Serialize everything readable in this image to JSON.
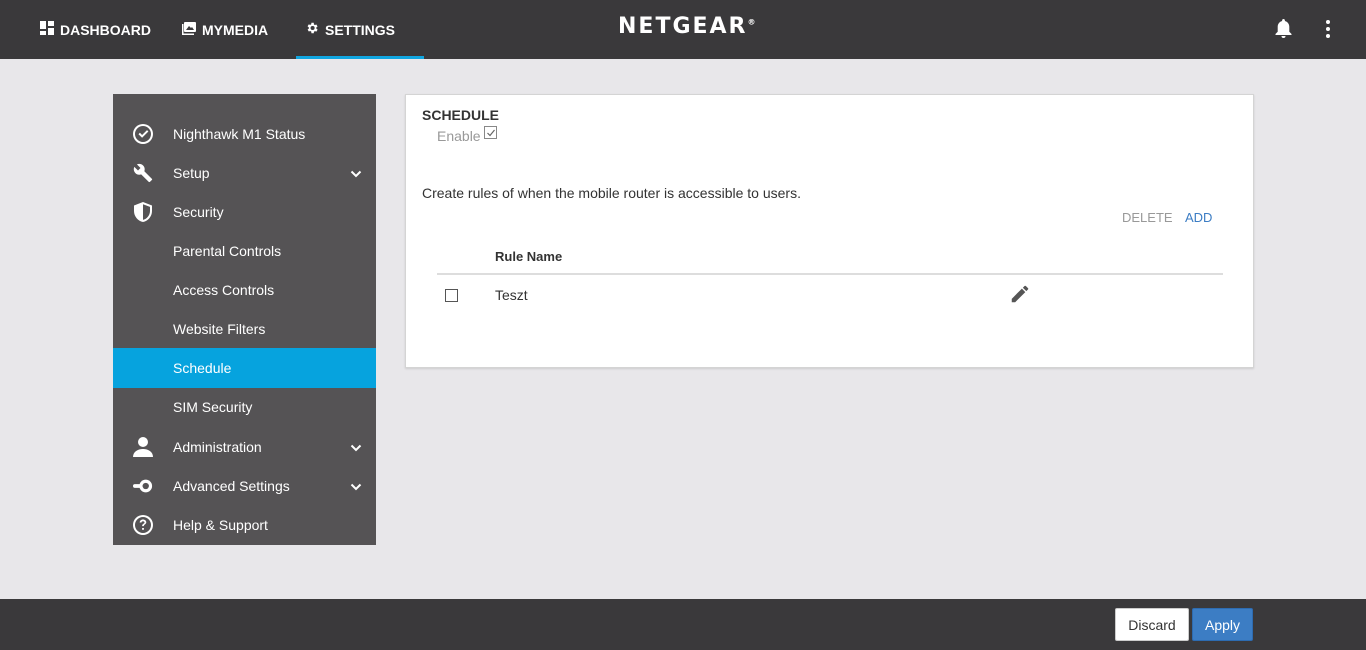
{
  "topnav": {
    "tabs": [
      {
        "label": "DASHBOARD",
        "icon": "dashboard-icon"
      },
      {
        "label": "MYMEDIA",
        "icon": "media-icon"
      },
      {
        "label": "SETTINGS",
        "icon": "gear-icon",
        "active": true
      }
    ],
    "brand": "NETGEAR",
    "brand_mark": "®",
    "accent_color": "#11a6e0"
  },
  "sidebar": {
    "items": [
      {
        "label": "Nighthawk M1 Status",
        "icon": "check-circle-icon"
      },
      {
        "label": "Setup",
        "icon": "wrench-icon",
        "expandable": true
      },
      {
        "label": "Security",
        "icon": "shield-icon"
      },
      {
        "label": "Parental Controls"
      },
      {
        "label": "Access Controls"
      },
      {
        "label": "Website Filters"
      },
      {
        "label": "Schedule",
        "active": true
      },
      {
        "label": "SIM Security"
      },
      {
        "label": "Administration",
        "icon": "user-icon",
        "expandable": true
      },
      {
        "label": "Advanced Settings",
        "icon": "toggle-icon",
        "expandable": true
      },
      {
        "label": "Help & Support",
        "icon": "help-circle-icon"
      }
    ],
    "active_color": "#06a3de"
  },
  "schedule": {
    "title": "SCHEDULE",
    "enable_label": "Enable",
    "enable_checked": true,
    "description": "Create rules of when the mobile router is accessible to users.",
    "delete_label": "DELETE",
    "add_label": "ADD",
    "columns": [
      "Rule Name"
    ],
    "rows": [
      {
        "name": "Teszt",
        "checked": false
      }
    ]
  },
  "footer": {
    "discard_label": "Discard",
    "apply_label": "Apply",
    "apply_color": "#3c7dc4"
  }
}
